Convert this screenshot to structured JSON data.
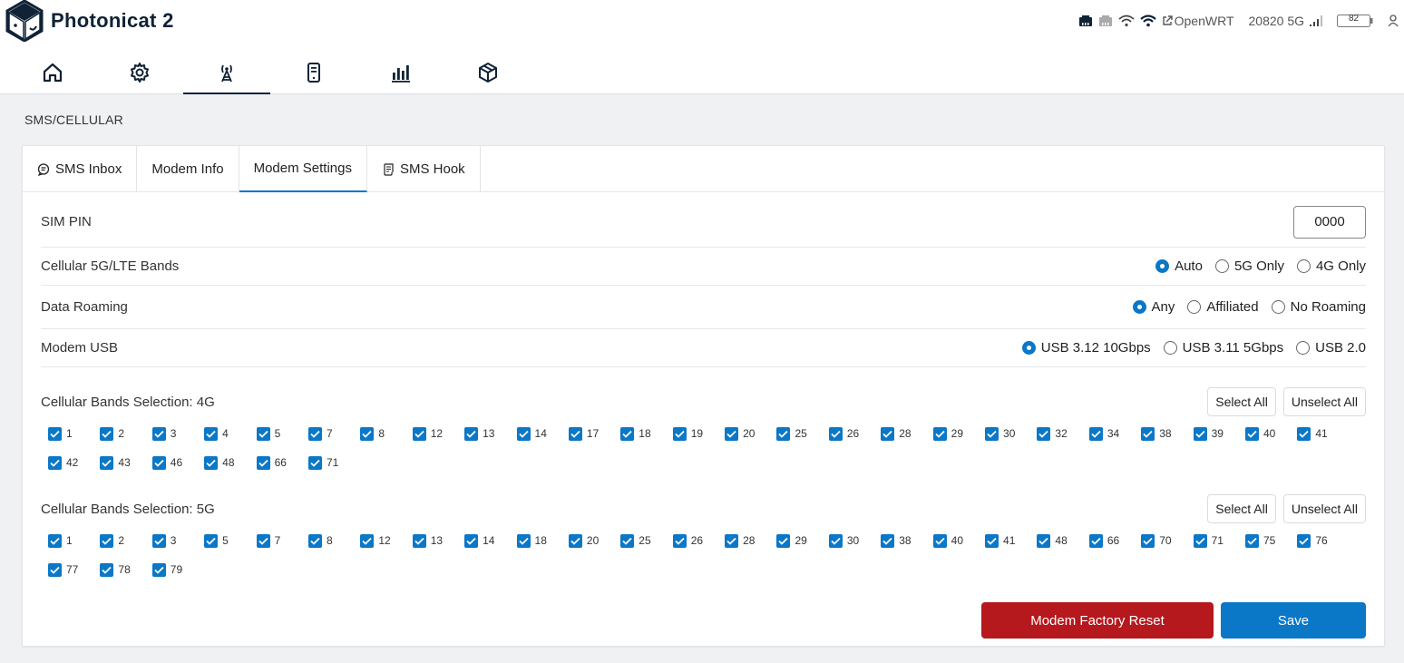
{
  "app": {
    "brand": "Photonicat 2"
  },
  "status": {
    "icons": [
      "ethernet-icon",
      "ethernet-inactive-icon",
      "wifi-icon",
      "wifi-strong-icon",
      "external-link-icon",
      "signal-icon",
      "battery-icon",
      "user-icon"
    ],
    "openwrt_label": "OpenWRT",
    "network": "20820 5G",
    "battery": "82"
  },
  "nav": {
    "items": [
      {
        "name": "home",
        "icon": "home-icon"
      },
      {
        "name": "settings",
        "icon": "gear-icon"
      },
      {
        "name": "cellular",
        "icon": "antenna-icon",
        "active": true
      },
      {
        "name": "device",
        "icon": "device-icon"
      },
      {
        "name": "stats",
        "icon": "bar-chart-icon"
      },
      {
        "name": "packages",
        "icon": "package-icon"
      }
    ]
  },
  "page": {
    "title": "SMS/CELLULAR"
  },
  "tabs": [
    {
      "label": "SMS Inbox",
      "icon": "chat-icon"
    },
    {
      "label": "Modem Info"
    },
    {
      "label": "Modem Settings",
      "active": true
    },
    {
      "label": "SMS Hook",
      "icon": "script-icon"
    }
  ],
  "settings": {
    "sim_pin": {
      "label": "SIM PIN",
      "value": "0000"
    },
    "bands_mode": {
      "label": "Cellular 5G/LTE Bands",
      "options": [
        "Auto",
        "5G Only",
        "4G Only"
      ],
      "selected": "Auto"
    },
    "roaming": {
      "label": "Data Roaming",
      "options": [
        "Any",
        "Affiliated",
        "No Roaming"
      ],
      "selected": "Any"
    },
    "usb": {
      "label": "Modem USB",
      "options": [
        "USB 3.12 10Gbps",
        "USB 3.11 5Gbps",
        "USB 2.0"
      ],
      "selected": "USB 3.12 10Gbps"
    }
  },
  "bands_4g": {
    "title": "Cellular Bands Selection: 4G",
    "select_all": "Select All",
    "unselect_all": "Unselect All",
    "bands": [
      "1",
      "2",
      "3",
      "4",
      "5",
      "7",
      "8",
      "12",
      "13",
      "14",
      "17",
      "18",
      "19",
      "20",
      "25",
      "26",
      "28",
      "29",
      "30",
      "32",
      "34",
      "38",
      "39",
      "40",
      "41",
      "42",
      "43",
      "46",
      "48",
      "66",
      "71"
    ]
  },
  "bands_5g": {
    "title": "Cellular Bands Selection: 5G",
    "select_all": "Select All",
    "unselect_all": "Unselect All",
    "bands": [
      "1",
      "2",
      "3",
      "5",
      "7",
      "8",
      "12",
      "13",
      "14",
      "18",
      "20",
      "25",
      "26",
      "28",
      "29",
      "30",
      "38",
      "40",
      "41",
      "48",
      "66",
      "70",
      "71",
      "75",
      "76",
      "77",
      "78",
      "79"
    ]
  },
  "actions": {
    "factory_reset": "Modem Factory Reset",
    "save": "Save"
  },
  "colors": {
    "primary": "#0b77c7",
    "danger": "#b5181d",
    "brand": "#0f2236"
  }
}
